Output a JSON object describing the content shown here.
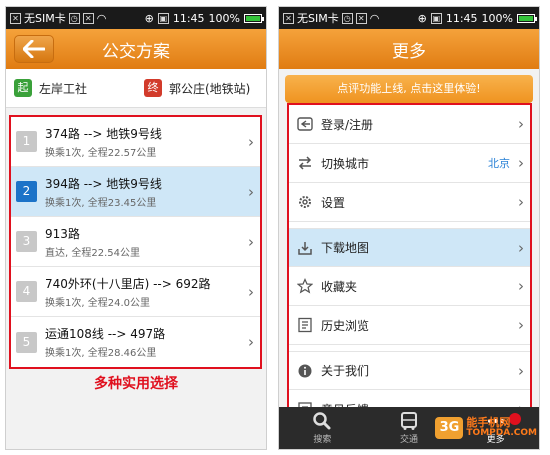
{
  "status_bar": {
    "carrier": "无SIM卡",
    "time": "11:45",
    "battery": "100%"
  },
  "left_screen": {
    "title": "公交方案",
    "start": {
      "badge": "起",
      "name": "左岸工社"
    },
    "end": {
      "badge": "终",
      "name": "郭公庄(地铁站)"
    },
    "routes": [
      {
        "num": "1",
        "title": "374路 --> 地铁9号线",
        "detail": "换乘1次, 全程22.57公里"
      },
      {
        "num": "2",
        "title": "394路 --> 地铁9号线",
        "detail": "换乘1次, 全程23.45公里"
      },
      {
        "num": "3",
        "title": "913路",
        "detail": "直达, 全程22.54公里"
      },
      {
        "num": "4",
        "title": "740外环(十八里店) --> 692路",
        "detail": "换乘1次, 全程24.0公里"
      },
      {
        "num": "5",
        "title": "运通108线 --> 497路",
        "detail": "换乘1次, 全程28.46公里"
      }
    ],
    "selected_route": 2,
    "caption": "多种实用选择"
  },
  "right_screen": {
    "title": "更多",
    "promo": "点评功能上线, 点击这里体验!",
    "menu": [
      {
        "label": "登录/注册",
        "icon": "login-icon"
      },
      {
        "label": "切换城市",
        "icon": "switch-arrows-icon",
        "value": "北京"
      },
      {
        "label": "设置",
        "icon": "gear-icon"
      },
      {
        "label": "下载地图",
        "icon": "download-icon"
      },
      {
        "label": "收藏夹",
        "icon": "star-icon"
      },
      {
        "label": "历史浏览",
        "icon": "history-icon"
      },
      {
        "label": "关于我们",
        "icon": "info-icon"
      },
      {
        "label": "意见反馈",
        "icon": "feedback-icon"
      }
    ],
    "selected_menu": "下载地图",
    "tabs": [
      {
        "label": "搜索",
        "icon": "search-icon"
      },
      {
        "label": "交通",
        "icon": "bus-icon"
      },
      {
        "label": "更多",
        "icon": "more-icon"
      }
    ]
  },
  "watermark": {
    "logo": "3G",
    "cn": "能手机网",
    "en": "TOMPDA.COM"
  },
  "colors": {
    "orange": "#e8891a",
    "highlight": "#cfe7f7",
    "frame_red": "#e0101e",
    "city_blue": "#2a82d6"
  }
}
